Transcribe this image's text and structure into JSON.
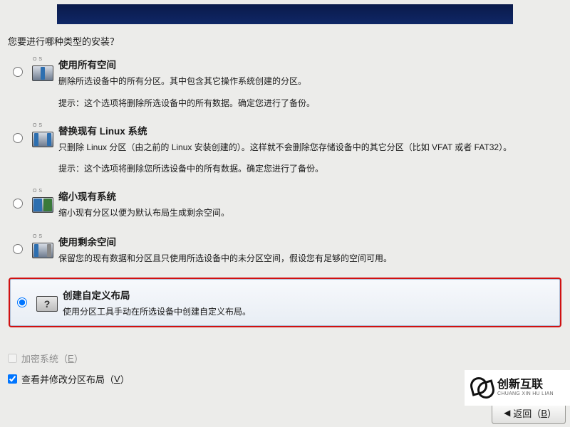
{
  "prompt": "您要进行哪种类型的安装？",
  "options": [
    {
      "title": "使用所有空间",
      "desc": "删除所选设备中的所有分区。其中包含其它操作系统创建的分区。",
      "hint": "提示：这个选项将删除所选设备中的所有数据。确定您进行了备份。",
      "selected": false
    },
    {
      "title": "替换现有 Linux 系统",
      "desc": "只删除 Linux 分区（由之前的 Linux 安装创建的）。这样就不会删除您存储设备中的其它分区（比如 VFAT 或者 FAT32）。",
      "hint": "提示：这个选项将删除您所选设备中的所有数据。确定您进行了备份。",
      "selected": false
    },
    {
      "title": "缩小现有系统",
      "desc": "缩小现有分区以便为默认布局生成剩余空间。",
      "hint": "",
      "selected": false
    },
    {
      "title": "使用剩余空间",
      "desc": "保留您的现有数据和分区且只使用所选设备中的未分区空间，假设您有足够的空间可用。",
      "hint": "",
      "selected": false
    },
    {
      "title": "创建自定义布局",
      "desc": "使用分区工具手动在所选设备中创建自定义布局。",
      "hint": "",
      "selected": true
    }
  ],
  "checkboxes": {
    "encrypt_label_prefix": "加密系统（",
    "encrypt_label_key": "E",
    "encrypt_label_suffix": "）",
    "review_label_prefix": "查看并修改分区布局（",
    "review_label_key": "V",
    "review_label_suffix": "）"
  },
  "buttons": {
    "back_prefix": "返回（",
    "back_key": "B",
    "back_suffix": "）"
  },
  "watermark": {
    "cn": "创新互联",
    "en": "CHUANG XIN HU LIAN"
  },
  "icon_os_label": "O S"
}
